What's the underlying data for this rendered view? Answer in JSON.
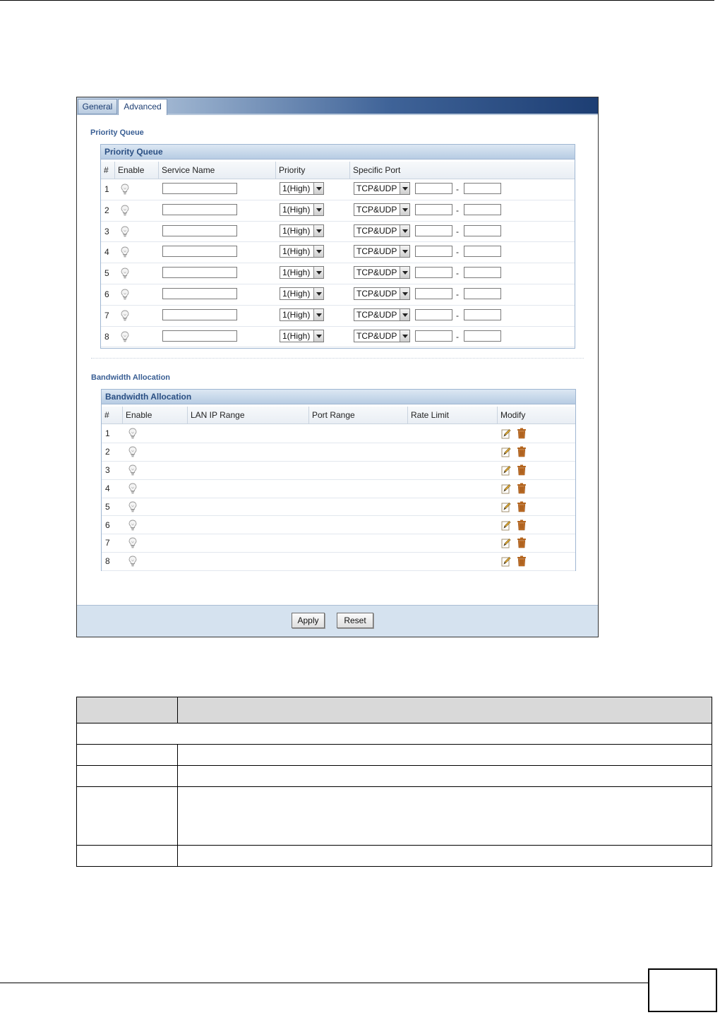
{
  "tabs": [
    {
      "label": "General",
      "active": false
    },
    {
      "label": "Advanced",
      "active": true
    }
  ],
  "priority_queue": {
    "section_title": "Priority Queue",
    "panel_title": "Priority Queue",
    "columns": [
      "#",
      "Enable",
      "Service Name",
      "Priority",
      "Specific Port"
    ],
    "rows": [
      {
        "num": "1",
        "service_name": "",
        "priority": "1(High)",
        "protocol": "TCP&UDP",
        "port_start": "",
        "port_end": ""
      },
      {
        "num": "2",
        "service_name": "",
        "priority": "1(High)",
        "protocol": "TCP&UDP",
        "port_start": "",
        "port_end": ""
      },
      {
        "num": "3",
        "service_name": "",
        "priority": "1(High)",
        "protocol": "TCP&UDP",
        "port_start": "",
        "port_end": ""
      },
      {
        "num": "4",
        "service_name": "",
        "priority": "1(High)",
        "protocol": "TCP&UDP",
        "port_start": "",
        "port_end": ""
      },
      {
        "num": "5",
        "service_name": "",
        "priority": "1(High)",
        "protocol": "TCP&UDP",
        "port_start": "",
        "port_end": ""
      },
      {
        "num": "6",
        "service_name": "",
        "priority": "1(High)",
        "protocol": "TCP&UDP",
        "port_start": "",
        "port_end": ""
      },
      {
        "num": "7",
        "service_name": "",
        "priority": "1(High)",
        "protocol": "TCP&UDP",
        "port_start": "",
        "port_end": ""
      },
      {
        "num": "8",
        "service_name": "",
        "priority": "1(High)",
        "protocol": "TCP&UDP",
        "port_start": "",
        "port_end": ""
      }
    ],
    "separator": "-"
  },
  "bandwidth_allocation": {
    "section_title": "Bandwidth Allocation",
    "panel_title": "Bandwidth Allocation",
    "columns": [
      "#",
      "Enable",
      "LAN IP Range",
      "Port Range",
      "Rate Limit",
      "Modify"
    ],
    "rows": [
      {
        "num": "1"
      },
      {
        "num": "2"
      },
      {
        "num": "3"
      },
      {
        "num": "4"
      },
      {
        "num": "5"
      },
      {
        "num": "6"
      },
      {
        "num": "7"
      },
      {
        "num": "8"
      }
    ]
  },
  "buttons": {
    "apply": "Apply",
    "reset": "Reset"
  },
  "icons": {
    "enable": "lightbulb-icon",
    "edit": "edit-icon",
    "delete": "trash-icon"
  },
  "colors": {
    "accent": "#3a5f94",
    "tab_bar_dark": "#1d3e73",
    "footer": "#d5e2ef",
    "icon_brown": "#b5651d"
  }
}
